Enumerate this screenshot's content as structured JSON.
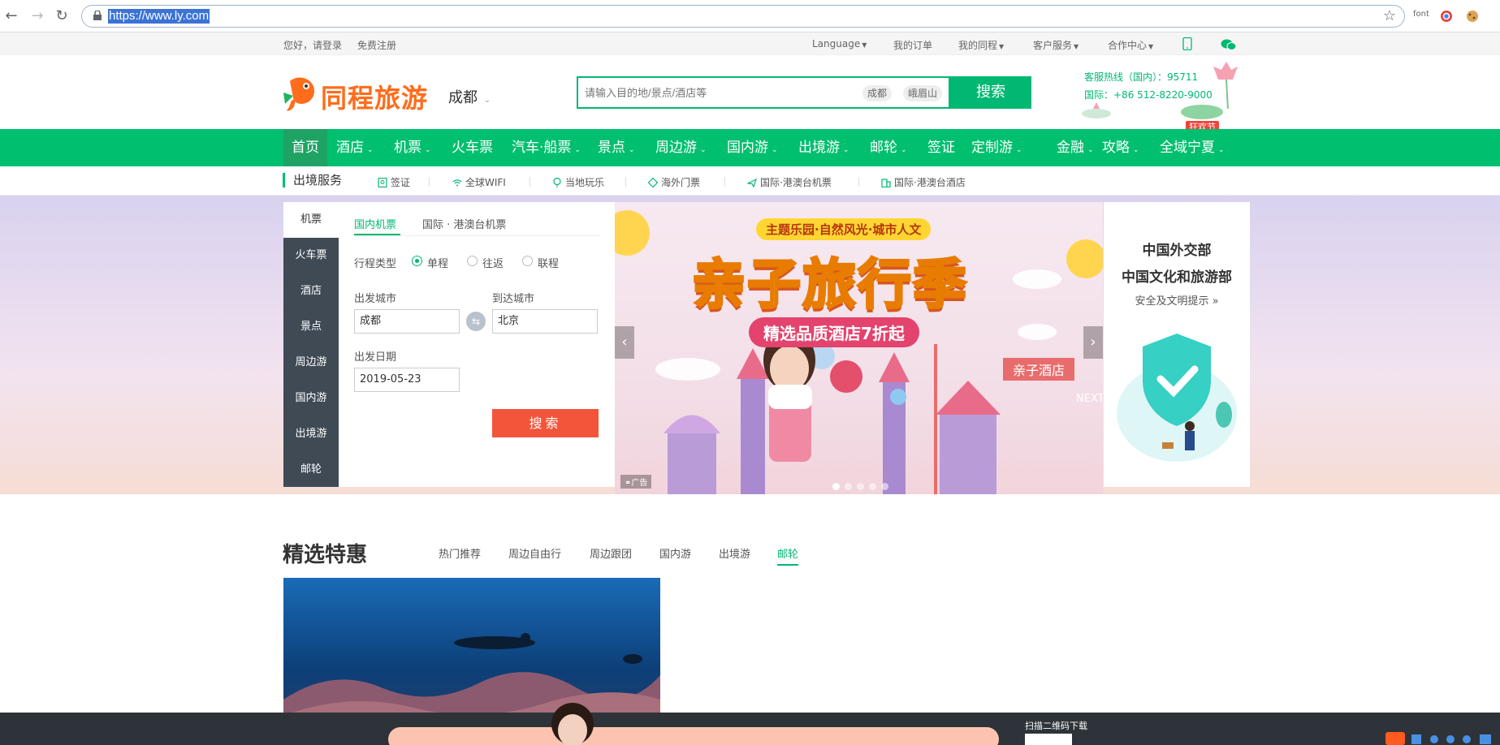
{
  "browser": {
    "url": "https://www.ly.com",
    "extension_label": "font"
  },
  "topbar": {
    "greeting": "您好，请登录",
    "register": "免费注册",
    "language": "Language",
    "my_orders": "我的订单",
    "my_trips": "我的同程",
    "customer_service": "客户服务",
    "partner_center": "合作中心"
  },
  "header": {
    "logo_text": "同程旅游",
    "city": "成都",
    "search_placeholder": "请输入目的地/景点/酒店等",
    "search_chips": [
      "成都",
      "峨眉山"
    ],
    "search_button": "搜索",
    "hotline_domestic": "客服热线（国内）：95711",
    "hotline_intl": "国际：+86 512-8220-9000",
    "festival_badge": "狂欢节"
  },
  "main_nav": [
    {
      "label": "首页",
      "dropdown": false,
      "active": true
    },
    {
      "label": "酒店",
      "dropdown": true
    },
    {
      "label": "机票",
      "dropdown": true
    },
    {
      "label": "火车票",
      "dropdown": false
    },
    {
      "label": "汽车·船票",
      "dropdown": true
    },
    {
      "label": "景点",
      "dropdown": true
    },
    {
      "label": "周边游",
      "dropdown": true
    },
    {
      "label": "国内游",
      "dropdown": true
    },
    {
      "label": "出境游",
      "dropdown": true
    },
    {
      "label": "邮轮",
      "dropdown": true
    },
    {
      "label": "签证",
      "dropdown": false
    },
    {
      "label": "定制游",
      "dropdown": true
    },
    {
      "label": "金融",
      "dropdown": true
    },
    {
      "label": "攻略",
      "dropdown": true
    },
    {
      "label": "全域宁夏",
      "dropdown": true
    }
  ],
  "sub_nav": {
    "title": "出境服务",
    "items": [
      "签证",
      "全球WIFI",
      "当地玩乐",
      "海外门票",
      "国际·港澳台机票",
      "国际·港澳台酒店"
    ]
  },
  "booking": {
    "side_tabs": [
      "机票",
      "火车票",
      "酒店",
      "景点",
      "周边游",
      "国内游",
      "出境游",
      "邮轮"
    ],
    "tabs": [
      "国内机票",
      "国际 · 港澳台机票"
    ],
    "trip_type_label": "行程类型",
    "trip_types": [
      "单程",
      "往返",
      "联程"
    ],
    "selected_trip_type": "单程",
    "from_label": "出发城市",
    "from_value": "成都",
    "to_label": "到达城市",
    "to_value": "北京",
    "date_label": "出发日期",
    "date_value": "2019-05-23",
    "search_button": "搜索"
  },
  "banner": {
    "subtitle": "主题乐园·自然风光·城市人文",
    "title": "亲子旅行季",
    "promo": "精选品质酒店7折起",
    "sign": "亲子酒店",
    "next_sign": "NEXT",
    "ad_tag": "广告",
    "slide_count": 5,
    "active_slide": 0
  },
  "notice": {
    "line1": "中国外交部",
    "line2": "中国文化和旅游部",
    "link": "安全及文明提示 »"
  },
  "deals": {
    "title": "精选特惠",
    "tabs": [
      "热门推荐",
      "周边自由行",
      "周边跟团",
      "国内游",
      "出境游",
      "邮轮"
    ],
    "active_tab": "邮轮"
  },
  "bottom": {
    "qr_label": "扫描二维码下载"
  },
  "colors": {
    "brand_green": "#00bf6f",
    "brand_orange": "#ff6c1b",
    "search_red": "#f2553a"
  }
}
